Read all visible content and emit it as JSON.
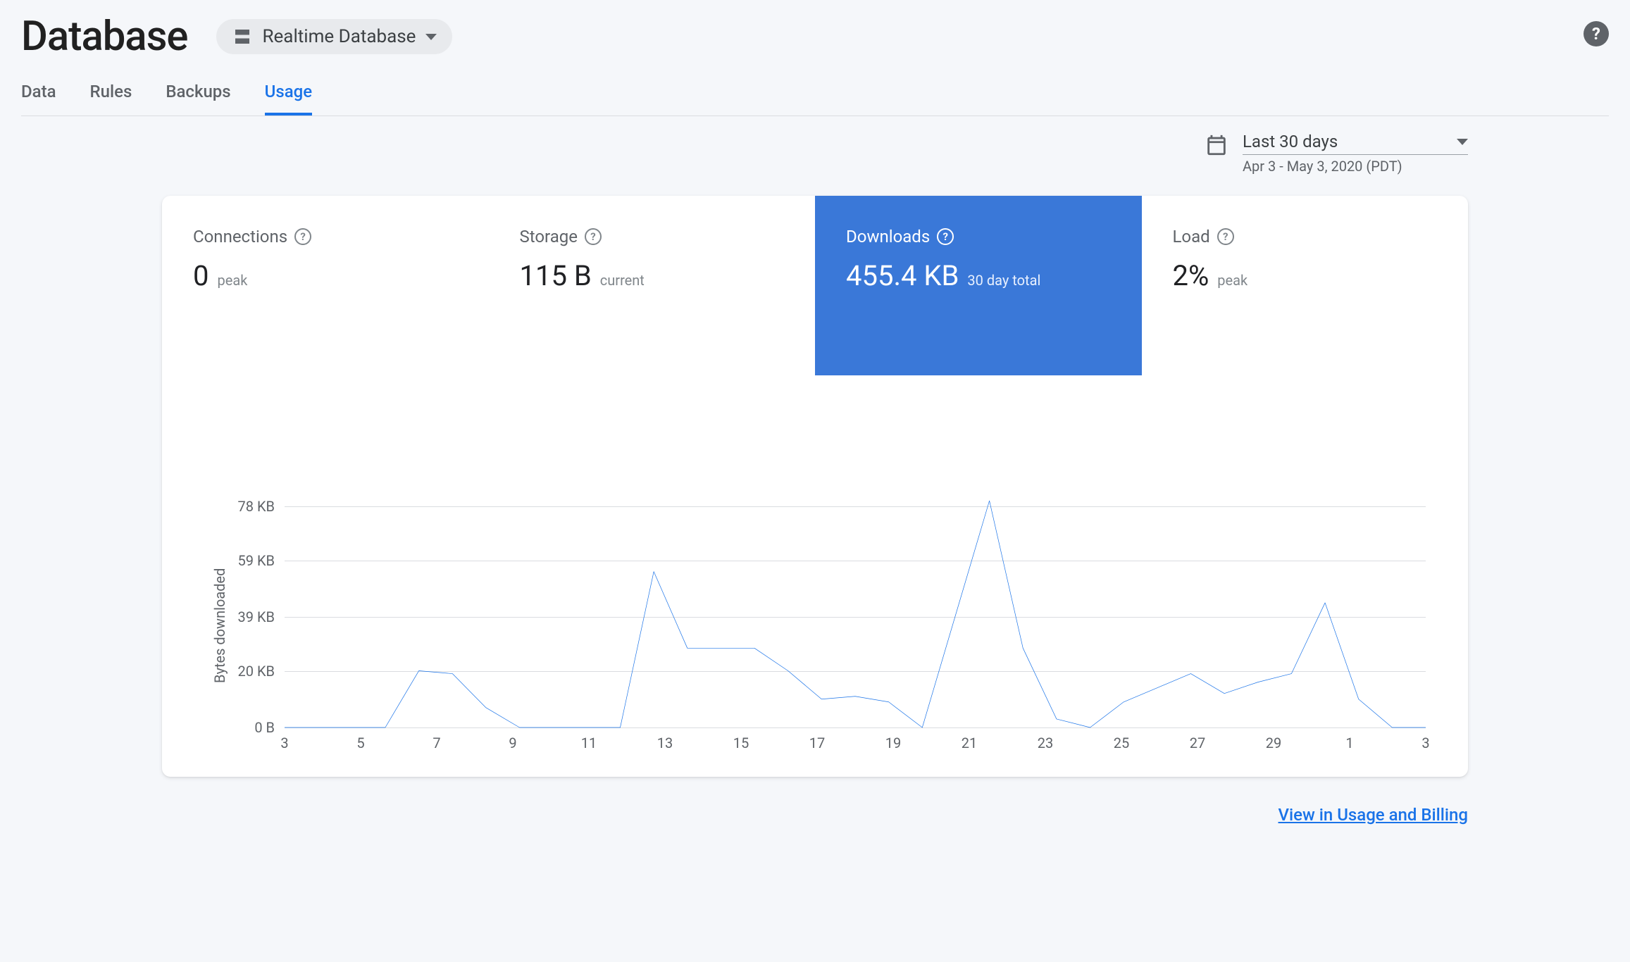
{
  "header": {
    "title": "Database",
    "selector_label": "Realtime Database"
  },
  "tabs": [
    "Data",
    "Rules",
    "Backups",
    "Usage"
  ],
  "active_tab": "Usage",
  "date_picker": {
    "label": "Last 30 days",
    "range": "Apr 3 - May 3, 2020 (PDT)"
  },
  "metrics": {
    "connections": {
      "title": "Connections",
      "value": "0",
      "sub": "peak"
    },
    "storage": {
      "title": "Storage",
      "value": "115 B",
      "sub": "current"
    },
    "downloads": {
      "title": "Downloads",
      "value": "455.4 KB",
      "sub": "30 day total"
    },
    "load": {
      "title": "Load",
      "value": "2%",
      "sub": "peak"
    }
  },
  "active_metric": "downloads",
  "footer_link": "View in Usage and Billing",
  "chart_data": {
    "type": "line",
    "title": "",
    "ylabel": "Bytes downloaded",
    "xlabel": "",
    "y_ticks": [
      0,
      20,
      39,
      59,
      78
    ],
    "y_tick_labels": [
      "0 B",
      "20 KB",
      "39 KB",
      "59 KB",
      "78 KB"
    ],
    "ylim": [
      0,
      82
    ],
    "x_labels_shown": [
      "3",
      "5",
      "7",
      "9",
      "11",
      "13",
      "15",
      "17",
      "19",
      "21",
      "23",
      "25",
      "27",
      "29",
      "1",
      "3"
    ],
    "x": [
      "3",
      "4",
      "5",
      "6",
      "7",
      "8",
      "9",
      "10",
      "11",
      "12",
      "13",
      "14",
      "15",
      "16",
      "17",
      "18",
      "19",
      "20",
      "21",
      "22",
      "23",
      "24",
      "25",
      "26",
      "27",
      "28",
      "29",
      "30",
      "1",
      "2",
      "3"
    ],
    "values": [
      0,
      0,
      0,
      0,
      20,
      19,
      7,
      0,
      0,
      0,
      0,
      55,
      28,
      28,
      28,
      20,
      10,
      11,
      9,
      0,
      40,
      80,
      28,
      3,
      0,
      9,
      14,
      19,
      12,
      16,
      19,
      44,
      10,
      0,
      0
    ],
    "color": "#1a73e8"
  }
}
